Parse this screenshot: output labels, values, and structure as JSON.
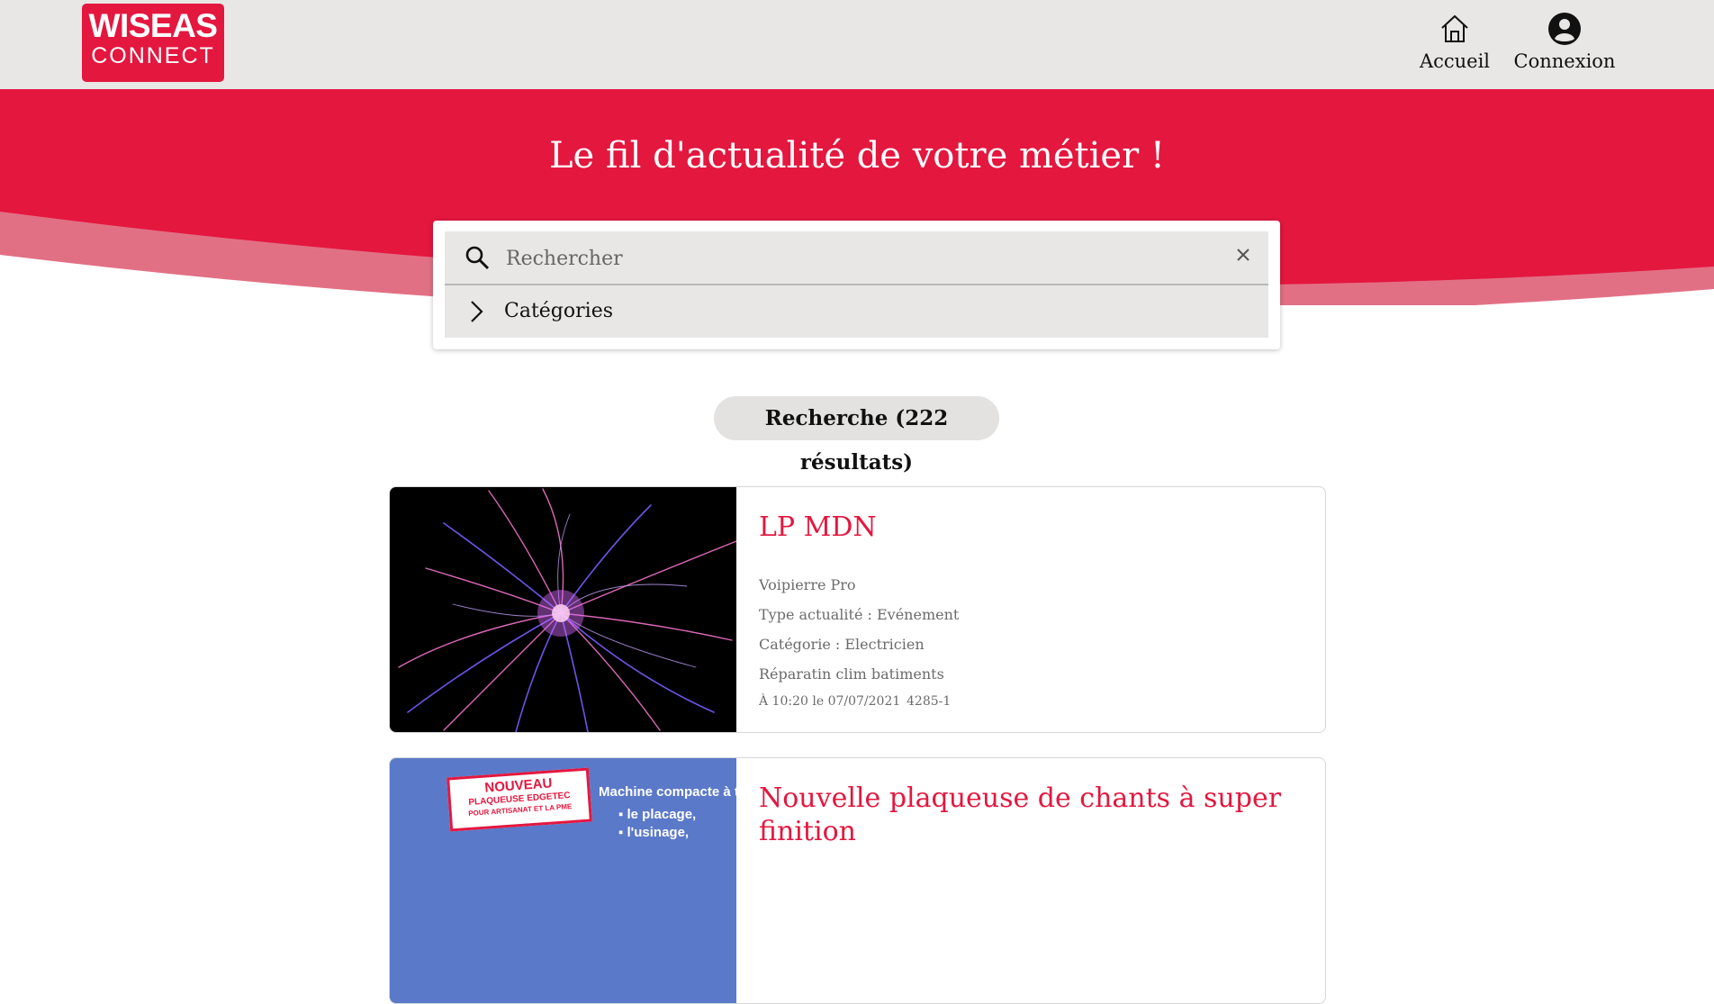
{
  "brand": {
    "line1": "WISEAS",
    "line2": "CONNECT",
    "color": "#e4173f"
  },
  "nav": {
    "home_label": "Accueil",
    "home_icon": "home-icon",
    "login_label": "Connexion",
    "login_icon": "account-circle-icon"
  },
  "hero": {
    "title": "Le fil d'actualité de votre métier !"
  },
  "search": {
    "placeholder": "Rechercher",
    "value": "",
    "icon": "search-icon",
    "clear_icon": "close-icon",
    "categories_label": "Catégories",
    "categories_icon": "chevron-right-icon"
  },
  "results": {
    "label": "Recherche (222 résultats)"
  },
  "cards": [
    {
      "title": "LP MDN",
      "author": "Voipierre Pro",
      "type": "Type actualité : Evénement",
      "category": "Catégorie : Electricien",
      "description": "Réparatin clim batiments",
      "datetime": "À 10:20 le 07/07/2021",
      "ref": "4285-1"
    },
    {
      "title": "Nouvelle plaqueuse de chants à super finition",
      "image_text": {
        "badge_line1": "NOUVEAU",
        "badge_line2": "PLAQUEUSE EDGETEC",
        "badge_line3": "POUR ARTISANAT ET LA PME",
        "headline": "Machine compacte à t",
        "bullet1": "le placage,",
        "bullet2": "l'usinage,"
      }
    }
  ]
}
